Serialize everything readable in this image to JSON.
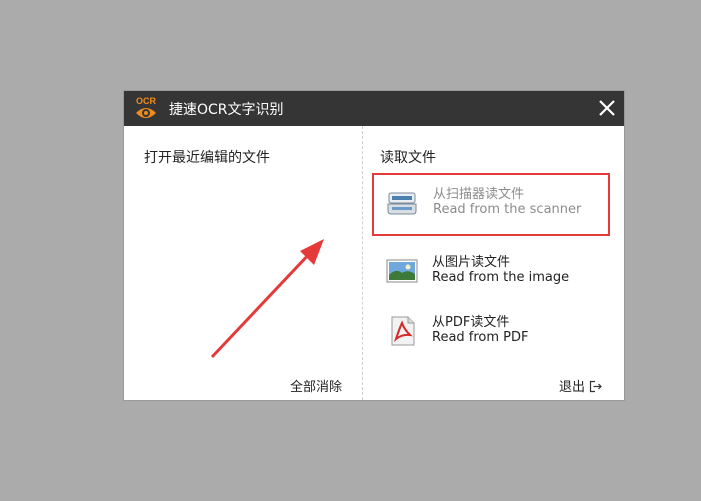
{
  "window": {
    "logo_text": "OCR",
    "title": "捷速OCR文字识别"
  },
  "left_panel": {
    "heading": "打开最近编辑的文件",
    "clear_all_label": "全部消除"
  },
  "right_panel": {
    "heading": "读取文件",
    "sources": [
      {
        "icon": "scanner-icon",
        "label_cn": "从扫描器读文件",
        "label_en": "Read from the scanner",
        "state": "disabled-highlighted"
      },
      {
        "icon": "image-file-icon",
        "label_cn": "从图片读文件",
        "label_en": "Read from the image",
        "state": "normal"
      },
      {
        "icon": "pdf-file-icon",
        "label_cn": "从PDF读文件",
        "label_en": "Read from PDF",
        "state": "normal"
      }
    ],
    "exit_label": "退出"
  },
  "colors": {
    "titlebar": "#353535",
    "highlight_border": "#e53a3a",
    "annotation_arrow": "#e53a3a",
    "logo_orange": "#f08c1e"
  }
}
